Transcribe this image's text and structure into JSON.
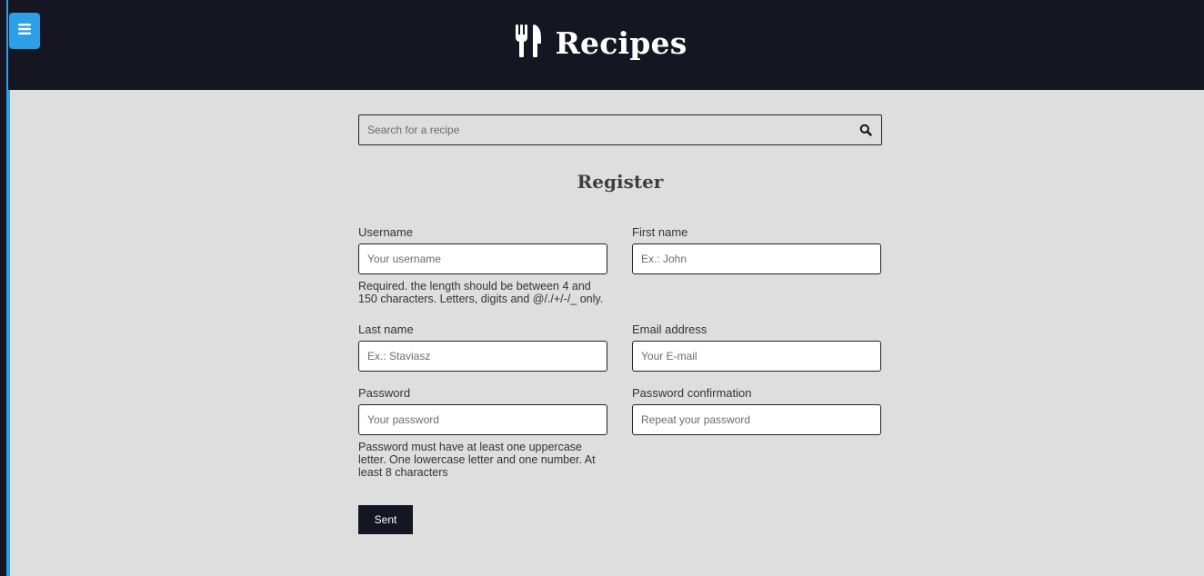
{
  "app": {
    "title": "Recipes"
  },
  "header": {
    "menu_icon": "hamburger-icon",
    "brand_icon": "utensils-icon"
  },
  "search": {
    "placeholder": "Search for a recipe",
    "value": "",
    "icon": "search-icon"
  },
  "form": {
    "title": "Register",
    "username": {
      "label": "Username",
      "placeholder": "Your username",
      "value": "",
      "help": "Required. the length should be between 4 and 150 characters. Letters, digits and @/./+/-/_ only."
    },
    "first_name": {
      "label": "First name",
      "placeholder": "Ex.: John",
      "value": ""
    },
    "last_name": {
      "label": "Last name",
      "placeholder": "Ex.: Staviasz",
      "value": ""
    },
    "email": {
      "label": "Email address",
      "placeholder": "Your E-mail",
      "value": ""
    },
    "password": {
      "label": "Password",
      "placeholder": "Your password",
      "value": "",
      "help": "Password must have at least one uppercase letter. One lowercase letter and one number. At least 8 characters"
    },
    "password_confirmation": {
      "label": "Password confirmation",
      "placeholder": "Repeat your password",
      "value": ""
    },
    "submit_label": "Sent"
  },
  "colors": {
    "header_bg": "#151622",
    "accent": "#2d9fe6",
    "page_bg": "#dedede"
  }
}
